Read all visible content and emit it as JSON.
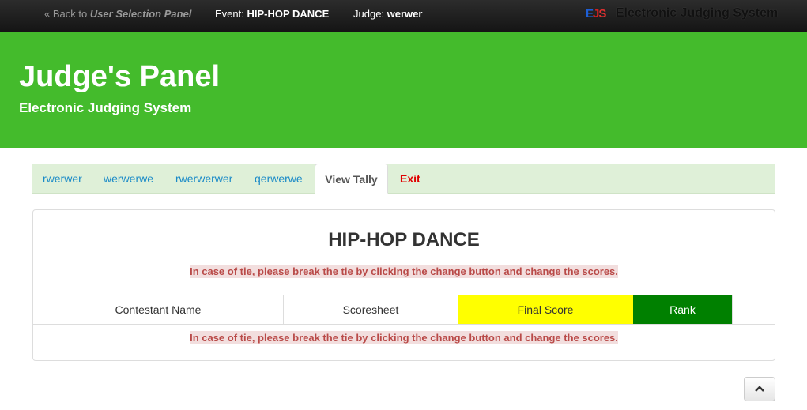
{
  "topbar": {
    "back_prefix": "« Back to ",
    "back_target": "User Selection Panel",
    "event_label": "Event: ",
    "event_value": "HIP-HOP DANCE",
    "judge_label": "Judge: ",
    "judge_value": "werwer",
    "logo_text": "EJS",
    "brand_title": "Electronic Judging System"
  },
  "hero": {
    "title": "Judge's Panel",
    "subtitle": "Electronic Judging System"
  },
  "tabs": [
    {
      "label": "rwerwer"
    },
    {
      "label": "werwerwe"
    },
    {
      "label": "rwerwerwer"
    },
    {
      "label": "qerwerwe"
    },
    {
      "label": "View Tally",
      "active": true
    },
    {
      "label": "Exit"
    }
  ],
  "panel": {
    "title": "HIP-HOP DANCE",
    "notice_top": "In case of tie, please break the tie by clicking the change button and change the scores.",
    "notice_bottom": "In case of tie, please break the tie by clicking the change button and change the scores.",
    "columns": [
      "Contestant Name",
      "Scoresheet",
      "Final Score",
      "Rank",
      ""
    ]
  },
  "colors": {
    "hero_green": "#44bb2c",
    "final_score_bg": "#ffff00",
    "rank_bg": "#008000",
    "exit_red": "#e00000",
    "link_blue": "#1a8ac7"
  },
  "icons": {
    "back_to_top": "chevron-up-icon"
  }
}
